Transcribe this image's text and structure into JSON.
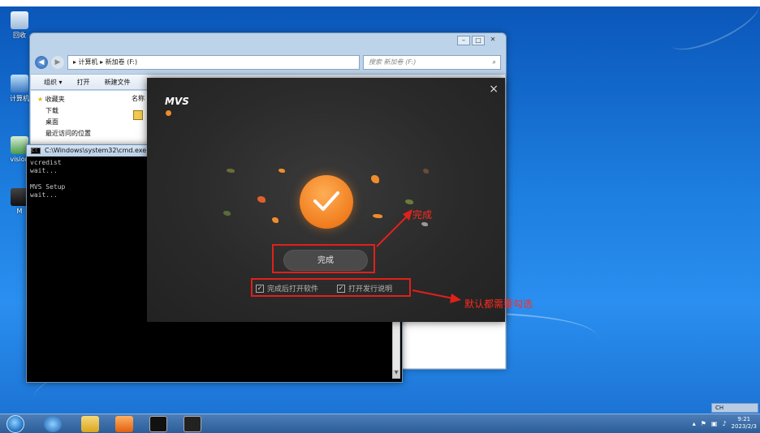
{
  "desktop": {
    "icons": [
      {
        "label": "回收"
      },
      {
        "label": "计算机"
      },
      {
        "label": "vision"
      },
      {
        "label": "M"
      }
    ]
  },
  "explorer": {
    "breadcrumb": "▸ 计算机 ▸ 新加卷 (F:)",
    "search_placeholder": "搜索 新加卷 (F:)",
    "toolbar": {
      "organize": "组织 ▾",
      "open": "打开",
      "new_folder": "新建文件"
    },
    "nav": {
      "favorites": "收藏夹",
      "downloads": "下载",
      "desktop": "桌面",
      "recent": "最近访问的位置"
    },
    "column_name": "名称"
  },
  "cmd": {
    "title": "C:\\Windows\\system32\\cmd.exe",
    "lines": "vcredist\nwait...\n\nMVS Setup\nwait..."
  },
  "mvs_dialog": {
    "logo": "MVS",
    "close_glyph": "×",
    "finish_button": "完成",
    "checkbox_open_software": {
      "label": "完成后打开软件",
      "checked": true
    },
    "checkbox_release_notes": {
      "label": "打开发行说明",
      "checked": true
    },
    "accent_color": "#f07d1e"
  },
  "annotations": {
    "finish_label": "完成",
    "checkbox_label": "默认都需要勾选",
    "color": "#e0211a"
  },
  "taskbar": {
    "language": "CH",
    "time": "9:21",
    "date": "2023/2/3"
  }
}
